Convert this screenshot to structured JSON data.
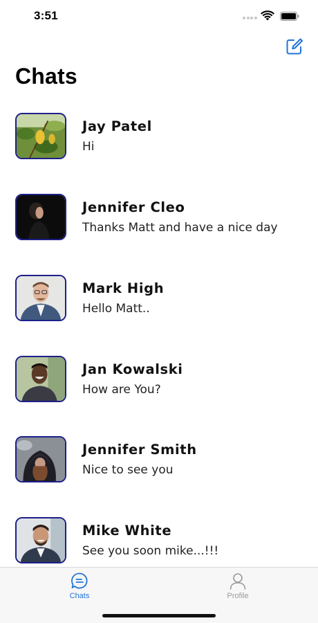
{
  "status_bar": {
    "time": "3:51"
  },
  "header": {
    "title": "Chats",
    "compose_icon": "compose-icon"
  },
  "chats": [
    {
      "name": "Jay Patel",
      "message": "Hi"
    },
    {
      "name": "Jennifer Cleo",
      "message": "Thanks Matt and have a nice day"
    },
    {
      "name": "Mark High",
      "message": "Hello Matt.."
    },
    {
      "name": "Jan Kowalski",
      "message": "How are You?"
    },
    {
      "name": "Jennifer Smith",
      "message": "Nice to see you"
    },
    {
      "name": "Mike White",
      "message": "See you soon mike...!!!"
    }
  ],
  "tab_bar": {
    "tabs": [
      {
        "label": "Chats",
        "icon": "chat-bubble-icon",
        "active": true
      },
      {
        "label": "Profile",
        "icon": "person-icon",
        "active": false
      }
    ]
  },
  "colors": {
    "accent": "#1f74d8",
    "avatar_border": "#1d1f8a",
    "inactive": "#9a9a9a"
  }
}
